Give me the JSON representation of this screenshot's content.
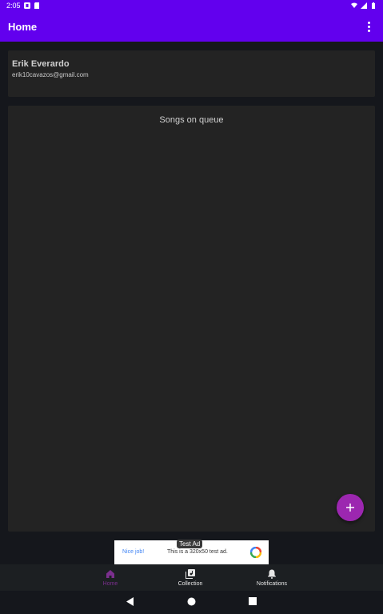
{
  "status_bar": {
    "time": "2:05"
  },
  "app_bar": {
    "title": "Home"
  },
  "profile": {
    "name": "Erik Everardo",
    "email": "erik10cavazos@gmail.com"
  },
  "queue": {
    "title": "Songs on queue"
  },
  "fab": {
    "label": "+"
  },
  "ad": {
    "tag": "Test Ad",
    "cta": "Nice job!",
    "text": "This is a 320x50 test ad."
  },
  "bottom_nav": {
    "items": [
      {
        "label": "Home",
        "icon": "home-icon",
        "active": true
      },
      {
        "label": "Collection",
        "icon": "library-music-icon",
        "active": false
      },
      {
        "label": "Notifications",
        "icon": "bell-icon",
        "active": false
      }
    ]
  },
  "colors": {
    "primary": "#6200ee",
    "accent": "#9c27b0",
    "active_nav": "#7b2f8e"
  }
}
